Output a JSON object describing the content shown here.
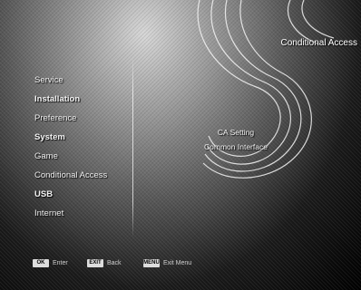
{
  "header": {
    "title": "Conditional Access"
  },
  "menu": {
    "items": [
      {
        "label": "Service",
        "bold": false
      },
      {
        "label": "Installation",
        "bold": true
      },
      {
        "label": "Preference",
        "bold": false
      },
      {
        "label": "System",
        "bold": true
      },
      {
        "label": "Game",
        "bold": false
      },
      {
        "label": "Conditional Access",
        "bold": false
      },
      {
        "label": "USB",
        "bold": true
      },
      {
        "label": "Internet",
        "bold": false
      }
    ]
  },
  "submenu": {
    "items": [
      {
        "label": "CA Setting"
      },
      {
        "label": "Common Interface"
      }
    ]
  },
  "footer": {
    "hints": [
      {
        "key": "OK",
        "label": "Enter"
      },
      {
        "key": "EXIT",
        "label": "Back"
      },
      {
        "key": "MENU",
        "label": "Exit Menu"
      }
    ]
  }
}
